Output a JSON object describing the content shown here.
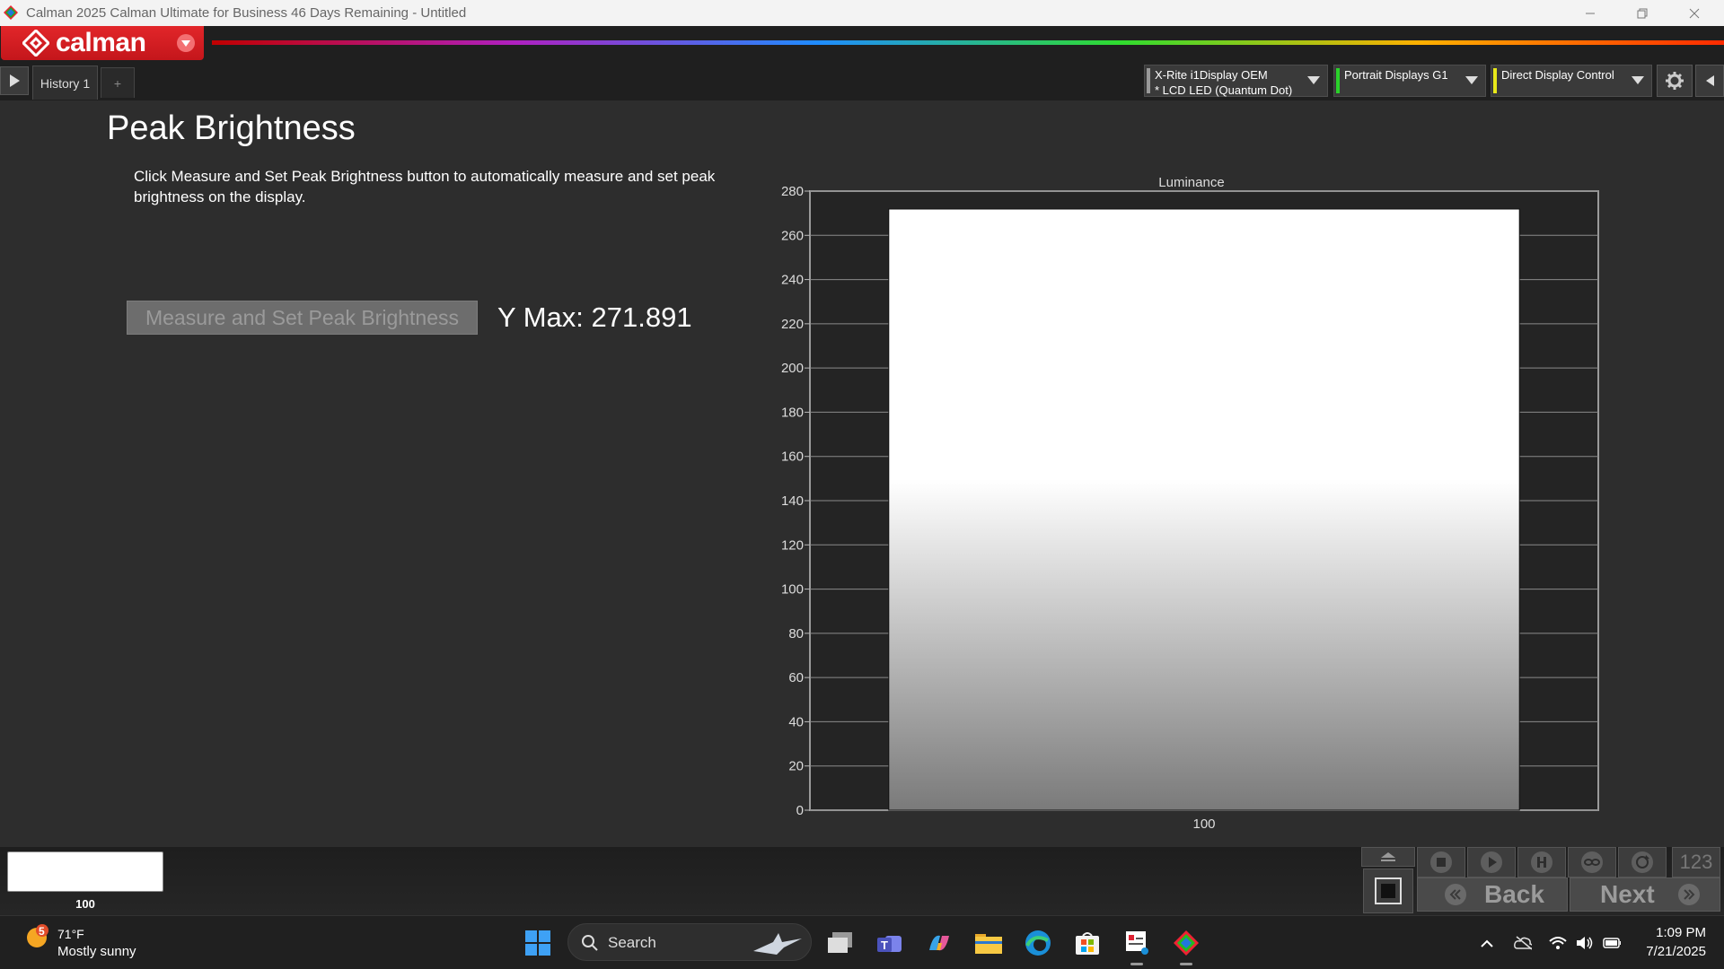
{
  "window": {
    "title": "Calman 2025 Calman Ultimate for Business 46 Days Remaining  - Untitled"
  },
  "toolbar": {
    "logo_text": "calman",
    "rainbow_colors": [
      "#c10000",
      "#b020c0",
      "#1f8cff",
      "#2fdc2f",
      "#ffb000",
      "#ff2a00"
    ]
  },
  "tabs": {
    "history_label": "History 1",
    "add_label": "+"
  },
  "devices": [
    {
      "line1": "X-Rite i1Display OEM",
      "line2": "* LCD LED (Quantum Dot)",
      "color": "#9a9a9a"
    },
    {
      "line1": "Portrait Displays G1",
      "line2": "",
      "color": "#2ad12a"
    },
    {
      "line1": "Direct Display Control",
      "line2": "",
      "color": "#e8e81a"
    }
  ],
  "main": {
    "title": "Peak Brightness",
    "description": "Click Measure and Set Peak Brightness button to automatically measure and set peak brightness on the display.",
    "measure_button_label": "Measure and Set Peak Brightness",
    "ymax_label": "Y Max: 271.891"
  },
  "chart_data": {
    "type": "bar",
    "title": "Luminance",
    "categories": [
      "100"
    ],
    "values": [
      271.891
    ],
    "ylim": [
      0,
      280
    ],
    "yticks": [
      0,
      20,
      40,
      60,
      80,
      100,
      120,
      140,
      160,
      180,
      200,
      220,
      240,
      260,
      280
    ],
    "grid": true,
    "bar_color_top": "#ffffff",
    "bar_color_bottom": "#7a7a7a"
  },
  "bottom": {
    "swatch_label": "100",
    "counter_label": "123",
    "back_label": "Back",
    "next_label": "Next"
  },
  "taskbar": {
    "weather_badge": "5",
    "weather_temp": "71°F",
    "weather_desc": "Mostly sunny",
    "search_label": "Search",
    "time": "1:09 PM",
    "date": "7/21/2025"
  }
}
